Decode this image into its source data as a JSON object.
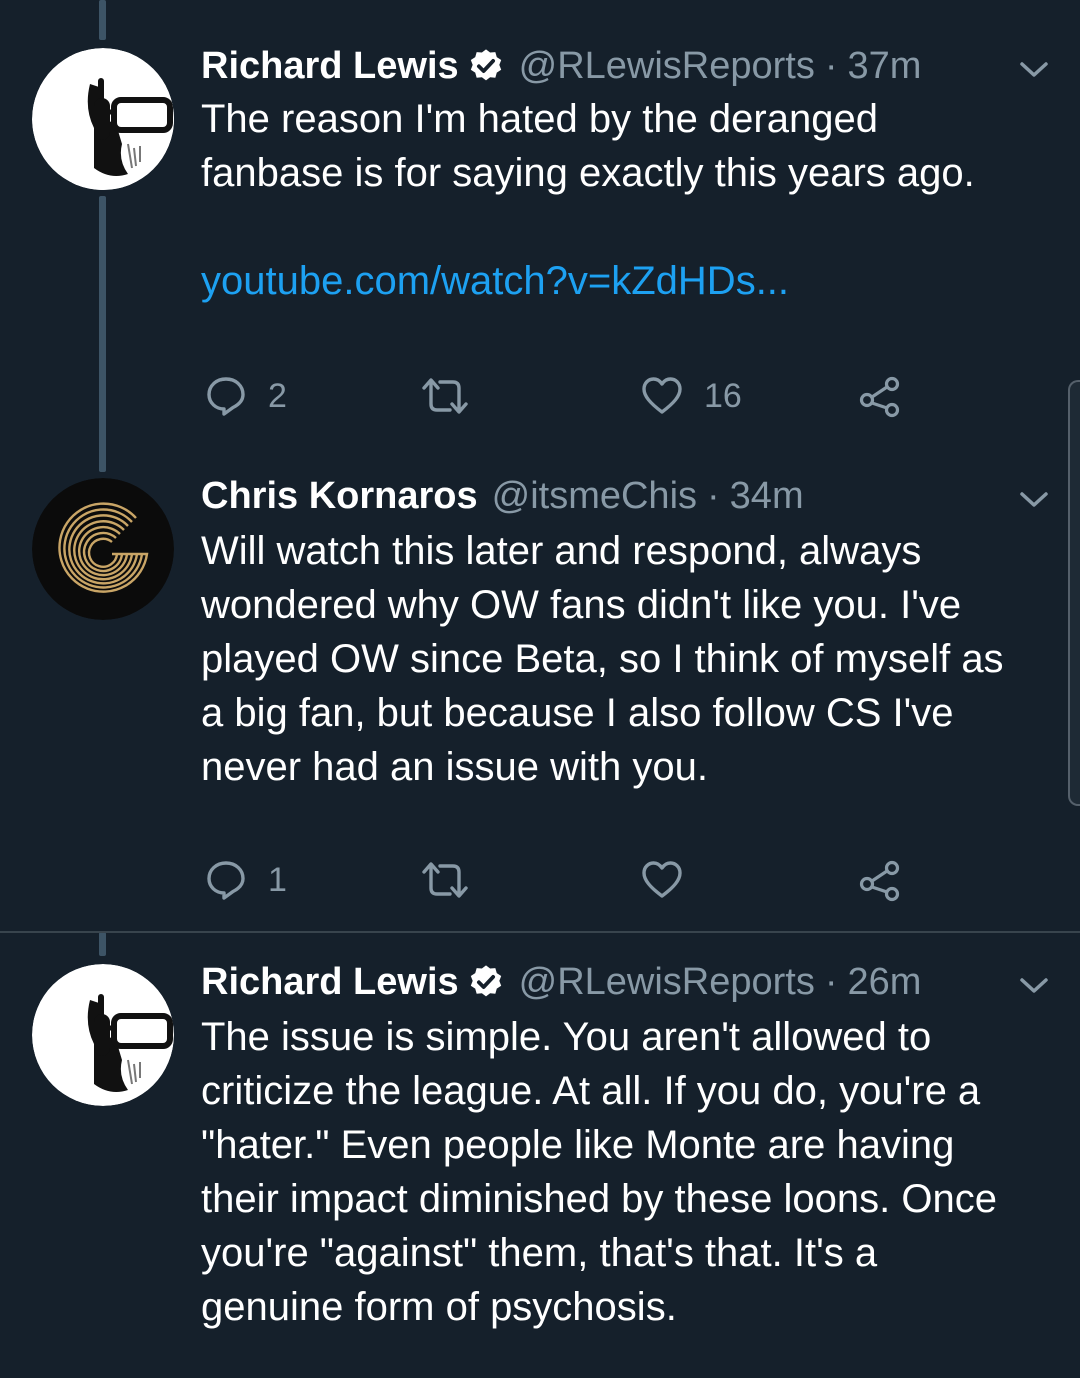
{
  "colors": {
    "background": "#15202b",
    "text_primary": "#ffffff",
    "text_secondary": "#8899a6",
    "link": "#1da1f2",
    "divider": "#38444d",
    "thread_line": "#3d5466"
  },
  "tweets": [
    {
      "display_name": "Richard Lewis",
      "verified": true,
      "handle": "@RLewisReports",
      "separator": "·",
      "time": "37m",
      "text_lines": [
        "The reason I'm hated by the deranged",
        "fanbase is for saying exactly this years ago."
      ],
      "link": "youtube.com/watch?v=kZdHDs...",
      "actions": {
        "reply_count": "2",
        "retweet_count": "",
        "like_count": "16"
      },
      "avatar_icon": "headphones-glasses-avatar-icon"
    },
    {
      "display_name": "Chris Kornaros",
      "verified": false,
      "handle": "@itsmeChis",
      "separator": "·",
      "time": "34m",
      "text_lines": [
        "Will watch this later and respond, always",
        "wondered why OW fans didn't like you. I've",
        "played OW since Beta, so I think of myself as",
        "a big fan, but because I also follow CS I've",
        "never had an issue with you."
      ],
      "actions": {
        "reply_count": "1",
        "retweet_count": "",
        "like_count": ""
      },
      "avatar_icon": "gold-g-logo-avatar-icon"
    },
    {
      "display_name": "Richard Lewis",
      "verified": true,
      "handle": "@RLewisReports",
      "separator": "·",
      "time": "26m",
      "text_lines": [
        "The issue is simple. You aren't allowed to",
        "criticize the league. At all. If you do, you're a",
        "\"hater.\" Even people like Monte are having",
        "their impact diminished by these loons. Once",
        "you're \"against\" them, that's that. It's a",
        "genuine form of psychosis."
      ],
      "avatar_icon": "headphones-glasses-avatar-icon"
    }
  ],
  "icons": {
    "reply": "reply-icon",
    "retweet": "retweet-icon",
    "like": "heart-icon",
    "share": "share-icon",
    "more": "chevron-down-icon",
    "verified": "verified-badge-icon"
  }
}
